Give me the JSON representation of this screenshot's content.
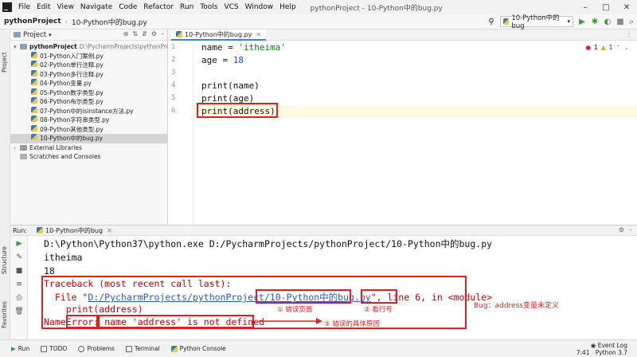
{
  "menubar": {
    "items": [
      "File",
      "Edit",
      "View",
      "Navigate",
      "Code",
      "Refactor",
      "Run",
      "Tools",
      "VCS",
      "Window",
      "Help"
    ],
    "title": "pythonProject - 10-Python中的bug.py"
  },
  "navbar": {
    "project": "pythonProject",
    "file": "10-Python中的bug.py",
    "run_config": "10-Python中的bug"
  },
  "left_strip": {
    "project_tab": "Project",
    "structure_tab": "Structure",
    "favorites_tab": "Favorites"
  },
  "project_panel": {
    "title": "Project",
    "root": {
      "name": "pythonProject",
      "path": "D:\\PycharmProjects\\pythonProject"
    },
    "files": [
      "01-Python入门案例.py",
      "02-Python单行注释.py",
      "03-Python多行注释.py",
      "04-Python变量.py",
      "05-Python数字类型.py",
      "06-Python布尔类型.py",
      "07-Python中的isinstance方法.py",
      "08-Python字符串类型.py",
      "09-Python其他类型.py",
      "10-Python中的bug.py"
    ],
    "external": "External Libraries",
    "scratches": "Scratches and Consoles"
  },
  "editor": {
    "tab": "10-Python中的bug.py",
    "line_numbers": [
      "1",
      "2",
      "3",
      "4",
      "5",
      "6"
    ],
    "lines": {
      "l1_pre": "name = ",
      "l1_str": "'itheima'",
      "l2_pre": "age = ",
      "l2_num": "18",
      "l4": "print(name)",
      "l5": "print(age)",
      "l6": "print(address)"
    },
    "inspection": {
      "errors": "1",
      "warnings": "1"
    }
  },
  "run": {
    "label": "Run:",
    "tab": "10-Python中的bug",
    "console": {
      "cmd": "D:\\Python\\Python37\\python.exe D:/PycharmProjects/pythonProject/10-Python中的bug.py",
      "out1": "itheima",
      "out2": "18",
      "tb1": "Traceback (most recent call last):",
      "tb2_pre": "  File \"",
      "tb2_link_a": "D:/PycharmProjects/pythonProject/",
      "tb2_link_b": "10-Python中的bug.py",
      "tb2_mid": "\", ",
      "tb2_line": "line 6",
      "tb2_post": ", in <module>",
      "tb3": "    print(address)",
      "tb4_a": "Name",
      "tb4_b": "Error",
      "tb4_c": ": ",
      "tb4_d": "name 'address' is not defined"
    },
    "annotations": {
      "a1": "① 错误页面",
      "a2": "② 看行号",
      "a3": "③ 错误的具体原因",
      "bug": "Bug：address变量未定义"
    }
  },
  "bottom": {
    "tabs": [
      "Run",
      "TODO",
      "Problems",
      "Terminal",
      "Python Console"
    ],
    "event_log": "Event Log",
    "position": "7:41",
    "interpreter": "Python 3.7"
  },
  "colors": {
    "annotation_red": "#e02020",
    "link_blue": "#2a54c6",
    "error_text": "#c40000"
  }
}
